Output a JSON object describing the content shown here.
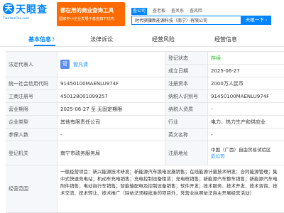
{
  "header": {
    "logo_badge": "天",
    "logo_text": "天眼查",
    "logo_sub": "TianYanCha.com",
    "banner_line1": "都在用的商业查询工具",
    "banner_line2": "国家中小企业发展子基金旗下机构",
    "search_tabs": [
      "查公司",
      "查老板",
      "查关系",
      "查风险"
    ],
    "search_value": "时代骐骥新能源科技（南宁）有限公司",
    "search_button": "天眼一下"
  },
  "nav": {
    "tabs": [
      {
        "label": "基本信息",
        "count": "3"
      },
      {
        "label": "法律诉讼",
        "count": ""
      },
      {
        "label": "经营风险",
        "count": ""
      },
      {
        "label": "经营信息",
        "count": ""
      }
    ]
  },
  "info": {
    "legal_rep_label": "法定代表人",
    "legal_rep_avatar": "管",
    "legal_rep_name": "管凡清",
    "reg_status_label": "登记状态",
    "reg_status_value": "存续",
    "est_date_label": "成立日期",
    "est_date_value": "2025-06-27",
    "credit_code_label": "统一社会信用代码",
    "credit_code_value": "91450100MAENLU974F",
    "reg_capital_label": "注册资本",
    "reg_capital_value": "2000万人民币",
    "biz_reg_label": "工商注册号",
    "biz_reg_value": "450128001099257",
    "taxpayer_id_label": "纳税人识别号",
    "taxpayer_id_value": "91450100MAENLU974F",
    "term_label": "营业期限",
    "term_value": "2025-06-27 至 无固定期限",
    "taxpayer_qual_label": "纳税人资质",
    "taxpayer_qual_value": "-",
    "type_label": "企业类型",
    "type_value": "其他有限责任公司",
    "industry_label": "行业",
    "industry_value": "电力、热力生产和供应业",
    "insured_label": "参保人数",
    "insured_value": "-",
    "english_label": "英文名称",
    "english_value": "-",
    "authority_label": "登记机关",
    "authority_value": "南宁市政务服务局",
    "address_label": "注册地址",
    "address_value": "中国（广西）自由贸易试验区",
    "address_more": "近公司",
    "scope_label": "经营范围",
    "scope_value": "一般经营项目：新兴能源技术研发；新能源汽车换电设施销售；在线能源计量技术研发；合同能源管理；集中式快速充电站；机动车充电销售；充电控制设备租赁；充电桩销售；新能源汽车整车销售；新能源汽车电附件销售；电动自行车销售；智能输配电及控制设备销售；软件开发；技术服务、技术开发、技术咨询、技术交流、技术转让、技术推广（除依法须经批准的项目外，凭营业执照依法自主开展经营活动）"
  },
  "colors": {
    "brand": "#0084ff",
    "banner": "#ff6a00",
    "status_green": "#2ab32a"
  }
}
